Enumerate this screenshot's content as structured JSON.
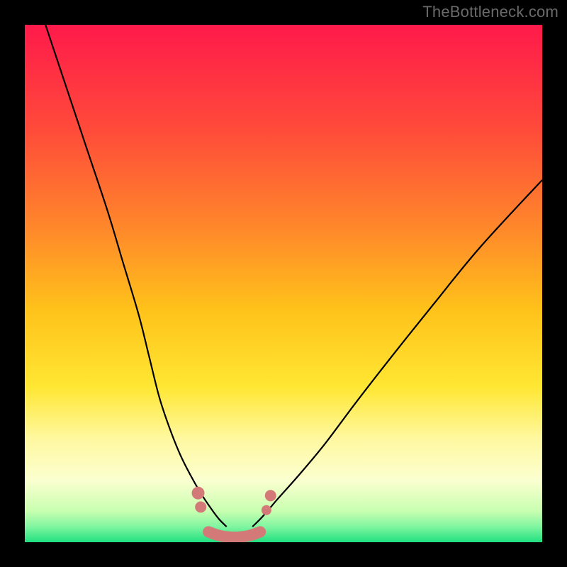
{
  "watermark": {
    "text": "TheBottleneck.com"
  },
  "chart_data": {
    "type": "line",
    "title": "",
    "xlabel": "",
    "ylabel": "",
    "xlim": [
      0,
      100
    ],
    "ylim": [
      0,
      100
    ],
    "grid": false,
    "legend": false,
    "background_gradient": {
      "stops": [
        {
          "pos": 0.0,
          "color": "#ff1a4b"
        },
        {
          "pos": 0.2,
          "color": "#ff4a3a"
        },
        {
          "pos": 0.4,
          "color": "#ff8a2a"
        },
        {
          "pos": 0.55,
          "color": "#ffc21a"
        },
        {
          "pos": 0.7,
          "color": "#ffe733"
        },
        {
          "pos": 0.8,
          "color": "#fff8a0"
        },
        {
          "pos": 0.88,
          "color": "#fbffd0"
        },
        {
          "pos": 0.94,
          "color": "#c8ffb0"
        },
        {
          "pos": 0.97,
          "color": "#80f5a0"
        },
        {
          "pos": 1.0,
          "color": "#20e080"
        }
      ]
    },
    "series": [
      {
        "name": "left-curve",
        "color": "#000000",
        "width": 2.2,
        "x": [
          4,
          8,
          12,
          16,
          19,
          22,
          24,
          26,
          28,
          30,
          32,
          34,
          36,
          37.5,
          39
        ],
        "y": [
          100,
          88,
          76,
          64,
          54,
          44,
          36,
          28,
          22,
          17,
          13,
          9.5,
          6.5,
          4.5,
          3
        ]
      },
      {
        "name": "right-curve",
        "color": "#000000",
        "width": 2.2,
        "x": [
          44,
          46,
          49,
          53,
          58,
          64,
          71,
          79,
          88,
          100
        ],
        "y": [
          3,
          5,
          8.5,
          13,
          19,
          27,
          36,
          46,
          57,
          70
        ]
      },
      {
        "name": "valley-base",
        "color": "#d37a78",
        "width": 16,
        "linecap": "round",
        "x": [
          35.5,
          37.5,
          39.5,
          41.5,
          43.5,
          45.5
        ],
        "y": [
          2.0,
          1.3,
          1.0,
          1.0,
          1.3,
          2.0
        ]
      },
      {
        "name": "left-valley-blob-1",
        "type": "scatter",
        "color": "#d37a78",
        "r": 9,
        "x": [
          33.5
        ],
        "y": [
          9.5
        ]
      },
      {
        "name": "left-valley-blob-2",
        "type": "scatter",
        "color": "#d37a78",
        "r": 8,
        "x": [
          34.0
        ],
        "y": [
          6.8
        ]
      },
      {
        "name": "right-valley-blob-1",
        "type": "scatter",
        "color": "#d37a78",
        "r": 8,
        "x": [
          47.5
        ],
        "y": [
          9.0
        ]
      },
      {
        "name": "right-valley-blob-2",
        "type": "scatter",
        "color": "#d37a78",
        "r": 7,
        "x": [
          46.7
        ],
        "y": [
          6.2
        ]
      }
    ]
  }
}
